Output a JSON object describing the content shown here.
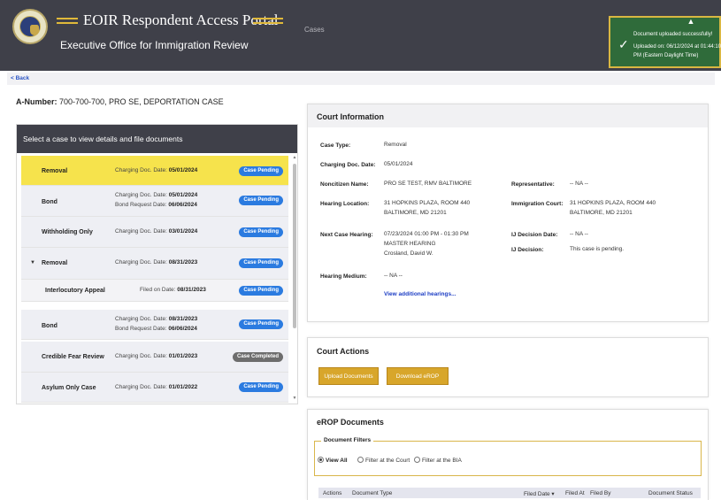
{
  "header": {
    "title": "EOIR Respondent Access Portal",
    "subtitle": "Executive Office for Immigration Review",
    "nav_cases": "Cases"
  },
  "toast": {
    "title": "Document uploaded successfully!",
    "detail": "Uploaded on: 06/12/2024 at 01:44:10 PM (Eastern Daylight Time)"
  },
  "back": "< Back",
  "a_number": {
    "label": "A-Number:",
    "value": "700-700-700, PRO SE, DEPORTATION CASE"
  },
  "case_list": {
    "heading": "Select a case to view details and file documents",
    "rows": [
      {
        "type": "Removal",
        "line1_label": "Charging Doc. Date:",
        "line1_value": "05/01/2024",
        "line2_label": "",
        "line2_value": "",
        "status": "Case Pending"
      },
      {
        "type": "Bond",
        "line1_label": "Charging Doc. Date:",
        "line1_value": "05/01/2024",
        "line2_label": "Bond Request Date:",
        "line2_value": "06/06/2024",
        "status": "Case Pending"
      },
      {
        "type": "Withholding Only",
        "line1_label": "Charging Doc. Date:",
        "line1_value": "03/01/2024",
        "line2_label": "",
        "line2_value": "",
        "status": "Case Pending"
      },
      {
        "type": "Removal",
        "line1_label": "Charging Doc. Date:",
        "line1_value": "08/31/2023",
        "line2_label": "",
        "line2_value": "",
        "status": "Case Pending"
      },
      {
        "type": "Interlocutory Appeal",
        "line1_label": "Filed on Date:",
        "line1_value": "08/31/2023",
        "line2_label": "",
        "line2_value": "",
        "status": "Case Pending"
      },
      {
        "type": "Bond",
        "line1_label": "Charging Doc. Date:",
        "line1_value": "08/31/2023",
        "line2_label": "Bond Request Date:",
        "line2_value": "06/06/2024",
        "status": "Case Pending"
      },
      {
        "type": "Credible Fear Review",
        "line1_label": "Charging Doc. Date:",
        "line1_value": "01/01/2023",
        "line2_label": "",
        "line2_value": "",
        "status": "Case Completed"
      },
      {
        "type": "Asylum Only Case",
        "line1_label": "Charging Doc. Date:",
        "line1_value": "01/01/2022",
        "line2_label": "",
        "line2_value": "",
        "status": "Case Pending"
      }
    ]
  },
  "court_info": {
    "heading": "Court Information",
    "case_type_label": "Case Type:",
    "case_type": "Removal",
    "charging_label": "Charging Doc. Date:",
    "charging_date": "05/01/2024",
    "noncitizen_label": "Noncitizen Name:",
    "noncitizen_name": "PRO SE TEST, RMV BALTIMORE",
    "representative_label": "Representative:",
    "representative": "-- NA --",
    "hearing_location_label": "Hearing Location:",
    "hearing_location_1": "31 HOPKINS PLAZA, ROOM 440",
    "hearing_location_2": "BALTIMORE, MD 21201",
    "immigration_court_label": "Immigration Court:",
    "immigration_court_1": "31 HOPKINS PLAZA, ROOM 440",
    "immigration_court_2": "BALTIMORE, MD 21201",
    "next_hearing_label": "Next Case Hearing:",
    "next_hearing_1": "07/23/2024   01:00 PM - 01:30 PM",
    "next_hearing_2": "MASTER HEARING",
    "next_hearing_3": "Crosland, David W.",
    "ij_decision_date_label": "IJ Decision Date:",
    "ij_decision_date": "-- NA --",
    "ij_decision_label": "IJ Decision:",
    "ij_decision": "This case is pending.",
    "hearing_medium_label": "Hearing Medium:",
    "hearing_medium": "-- NA --",
    "view_more": "View additional hearings..."
  },
  "court_actions": {
    "heading": "Court Actions",
    "upload": "Upload Documents",
    "download": "Download eROP"
  },
  "erop": {
    "heading": "eROP Documents",
    "filters_legend": "Document Filters",
    "filter_all": "View All",
    "filter_court": "Filter at the Court",
    "filter_bia": "Filter at the BIA",
    "columns": [
      "Actions",
      "Document Type",
      "Filed Date ▾",
      "Filed At",
      "Filed By",
      "Document Status"
    ]
  },
  "colors": {
    "header_bg": "#3f4049",
    "accent_gold": "#e0b93a",
    "active_row": "#f6e34c",
    "badge_blue": "#2b7be0",
    "badge_gray": "#6d6d6d",
    "button_gold": "#d8a62b",
    "toast_green": "#2f6b3a",
    "link_blue": "#1c3dc4"
  }
}
